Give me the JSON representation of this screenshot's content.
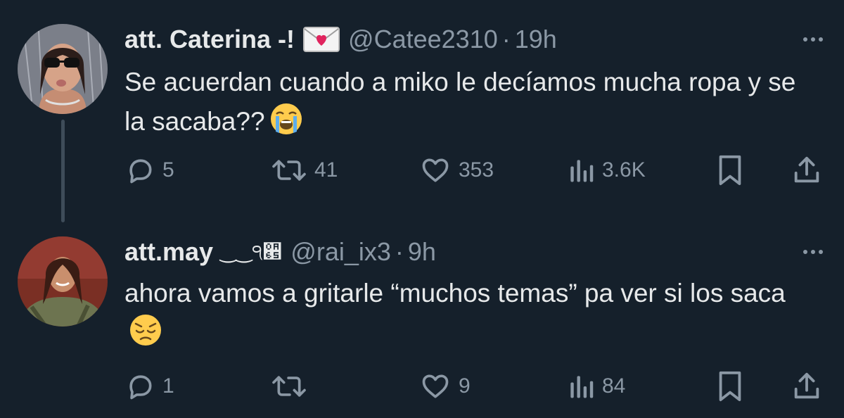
{
  "tweets": [
    {
      "display_name": "att. Caterina -!",
      "name_emoji": "love-letter-icon",
      "handle": "@Catee2310",
      "separator": "·",
      "time": "19h",
      "text": "Se acuerdan cuando a miko le decíamos mucha ropa y se la sacaba??",
      "text_emoji": "loudly-crying-face-icon",
      "replies": "5",
      "retweets": "41",
      "likes": "353",
      "views": "3.6K"
    },
    {
      "display_name": "att.may",
      "name_decoration": "‿‿੧੥",
      "handle": "@rai_ix3",
      "separator": "·",
      "time": "9h",
      "text": "ahora vamos a gritarle “muchos temas” pa ver si los saca",
      "text_emoji": "pensive-face-icon",
      "replies": "1",
      "retweets": "",
      "likes": "9",
      "views": "84"
    }
  ],
  "colors": {
    "background": "#15202b",
    "text_primary": "#e7e9ea",
    "text_secondary": "#8b98a5",
    "thread_line": "#3e4c59"
  }
}
